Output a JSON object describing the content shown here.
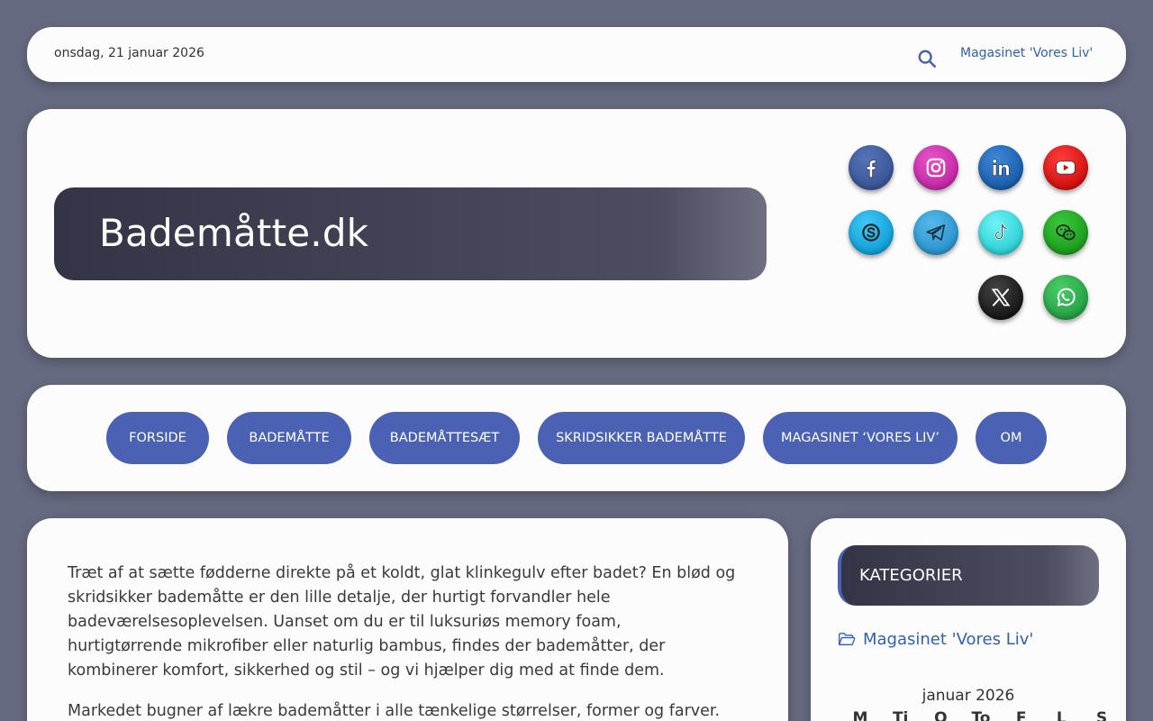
{
  "topbar": {
    "date": "onsdag, 21 januar 2026",
    "search_icon": "search-icon",
    "magazine_link": "Magasinet 'Vores Liv'"
  },
  "header": {
    "site_title": "Bademåtte.dk",
    "social": [
      {
        "name": "facebook",
        "color": "#3b5998"
      },
      {
        "name": "instagram",
        "color": "#d62ba8"
      },
      {
        "name": "linkedin",
        "color": "#0a66c2"
      },
      {
        "name": "youtube",
        "color": "#e00000"
      },
      {
        "name": "skype",
        "color": "#00aff0"
      },
      {
        "name": "telegram",
        "color": "#2aa3dd"
      },
      {
        "name": "tiktok",
        "color": "#2be0e6"
      },
      {
        "name": "wechat",
        "color": "#1aad19"
      },
      {
        "name": "x",
        "color": "#111111"
      },
      {
        "name": "whatsapp",
        "color": "#25b04a"
      }
    ]
  },
  "nav": {
    "items": [
      "FORSIDE",
      "BADEMÅTTE",
      "BADEMÅTTESÆT",
      "SKRIDSIKKER BADEMÅTTE",
      "MAGASINET ‘VORES LIV’",
      "OM"
    ]
  },
  "content": {
    "p1": "Træt af at sætte fødderne direkte på et koldt, glat klinkegulv efter badet? En blød og skridsikker bademåtte er den lille detalje, der hurtigt forvandler hele badeværelsesoplevelsen. Uanset om du er til luksuriøs memory foam, hurtigtørrende mikrofiber eller naturlig bambus, findes der bademåtter, der kombinerer komfort, sikkerhed og stil – og vi hjælper dig med at finde dem.",
    "p2": "Markedet bugner af lækre bademåtter i alle tænkelige størrelser, former og farver. Her"
  },
  "sidebar": {
    "widget_title": "KATEGORIER",
    "category": "Magasinet 'Vores Liv'",
    "calendar": {
      "caption": "januar 2026",
      "days": [
        "M",
        "Ti",
        "O",
        "To",
        "F",
        "L",
        "S"
      ]
    }
  },
  "colors": {
    "background": "#666a80",
    "accent": "#4b61b4",
    "link": "#2e62b0"
  }
}
